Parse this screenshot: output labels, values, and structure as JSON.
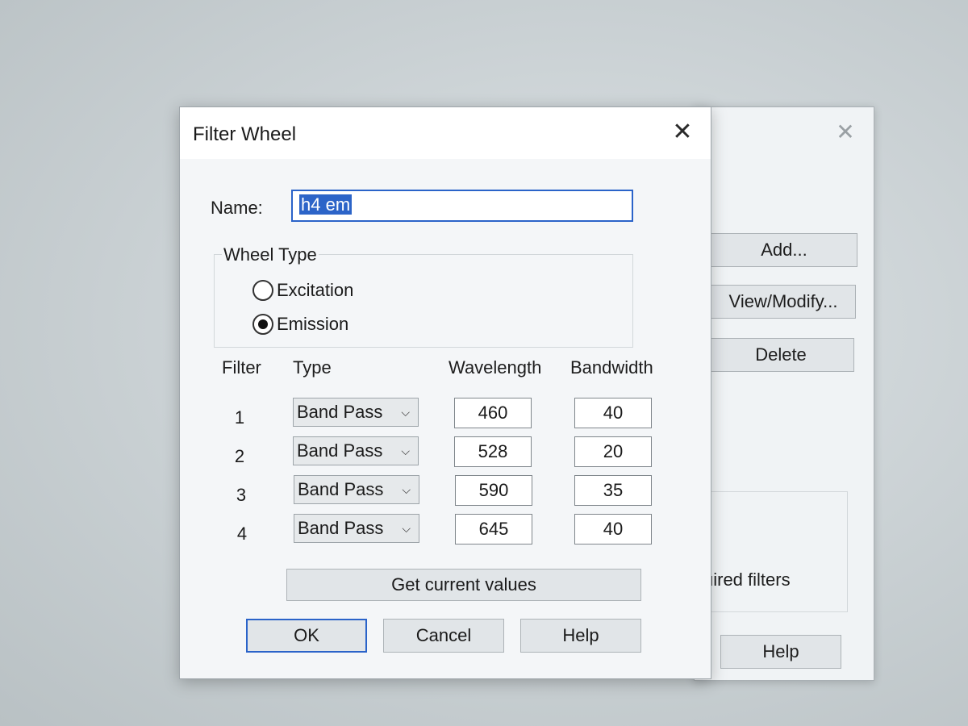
{
  "background_dialog": {
    "buttons": {
      "add": "Add...",
      "view_modify": "View/Modify...",
      "delete": "Delete",
      "help": "Help"
    },
    "partial_text": "uired filters"
  },
  "dialog": {
    "title": "Filter Wheel",
    "name_label": "Name:",
    "name_value": "h4 em",
    "wheel_type": {
      "label": "Wheel Type",
      "options": [
        "Excitation",
        "Emission"
      ],
      "selected": "Emission"
    },
    "columns": {
      "filter": "Filter",
      "type": "Type",
      "wavelength": "Wavelength",
      "bandwidth": "Bandwidth"
    },
    "filters": [
      {
        "num": "1",
        "type": "Band Pass",
        "wavelength": "460",
        "bandwidth": "40"
      },
      {
        "num": "2",
        "type": "Band Pass",
        "wavelength": "528",
        "bandwidth": "20"
      },
      {
        "num": "3",
        "type": "Band Pass",
        "wavelength": "590",
        "bandwidth": "35"
      },
      {
        "num": "4",
        "type": "Band Pass",
        "wavelength": "645",
        "bandwidth": "40"
      }
    ],
    "buttons": {
      "get_current": "Get current values",
      "ok": "OK",
      "cancel": "Cancel",
      "help": "Help"
    }
  },
  "icons": {
    "close": "close-icon",
    "dropdown": "chevron-down-icon"
  },
  "colors": {
    "accent": "#2a63c9",
    "selection": "#2c64c8"
  }
}
